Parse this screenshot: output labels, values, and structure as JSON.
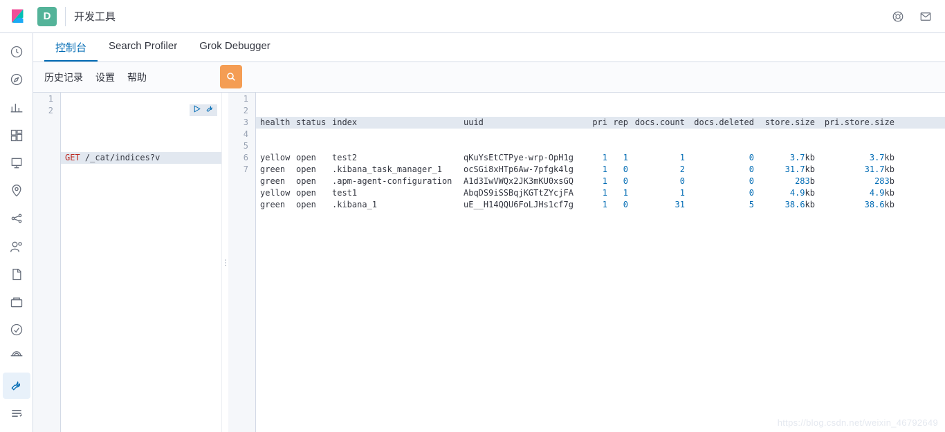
{
  "header": {
    "space_initial": "D",
    "app_title": "开发工具"
  },
  "tabs": [
    {
      "id": "console",
      "label": "控制台",
      "active": true
    },
    {
      "id": "profiler",
      "label": "Search Profiler",
      "active": false
    },
    {
      "id": "grok",
      "label": "Grok Debugger",
      "active": false
    }
  ],
  "subbar": {
    "history": "历史记录",
    "settings": "设置",
    "help": "帮助"
  },
  "request": {
    "lines": [
      {
        "n": 1,
        "method": "",
        "path": ""
      },
      {
        "n": 2,
        "method": "GET",
        "path": "/_cat/indices?v"
      }
    ]
  },
  "response": {
    "headers": [
      "health",
      "status",
      "index",
      "uuid",
      "pri",
      "rep",
      "docs.count",
      "docs.deleted",
      "store.size",
      "pri.store.size"
    ],
    "rows": [
      {
        "n": 2,
        "health": "yellow",
        "status": "open",
        "index": "test2",
        "uuid": "qKuYsEtCTPye-wrp-OpH1g",
        "pri": "1",
        "rep": "1",
        "count": "1",
        "del": "0",
        "ss": "3.7kb",
        "pss": "3.7kb"
      },
      {
        "n": 3,
        "health": "green",
        "status": "open",
        "index": ".kibana_task_manager_1",
        "uuid": "ocSGi8xHTp6Aw-7pfgk4lg",
        "pri": "1",
        "rep": "0",
        "count": "2",
        "del": "0",
        "ss": "31.7kb",
        "pss": "31.7kb"
      },
      {
        "n": 4,
        "health": "green",
        "status": "open",
        "index": ".apm-agent-configuration",
        "uuid": "A1d3IwVWQx2JK3mKU0xsGQ",
        "pri": "1",
        "rep": "0",
        "count": "0",
        "del": "0",
        "ss": "283b",
        "pss": "283b"
      },
      {
        "n": 5,
        "health": "yellow",
        "status": "open",
        "index": "test1",
        "uuid": "AbqDS9iSSBqjKGTtZYcjFA",
        "pri": "1",
        "rep": "1",
        "count": "1",
        "del": "0",
        "ss": "4.9kb",
        "pss": "4.9kb"
      },
      {
        "n": 6,
        "health": "green",
        "status": "open",
        "index": ".kibana_1",
        "uuid": "uE__H14QQU6FoLJHs1cf7g",
        "pri": "1",
        "rep": "0",
        "count": "31",
        "del": "5",
        "ss": "38.6kb",
        "pss": "38.6kb"
      }
    ],
    "trailing_line": 7,
    "header_line": 1
  },
  "watermark": "https://blog.csdn.net/weixin_46792649"
}
